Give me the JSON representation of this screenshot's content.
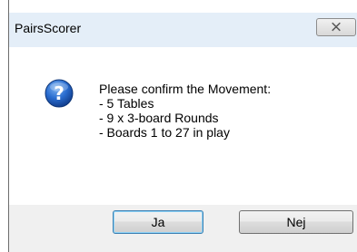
{
  "window": {
    "title": "PairsScorer",
    "close_icon": "close-icon"
  },
  "dialog": {
    "icon": "question-icon",
    "message_lines": [
      "Please confirm the Movement:",
      "- 5 Tables",
      "- 9 x 3-board Rounds",
      "- Boards 1 to 27 in play"
    ]
  },
  "buttons": {
    "yes_label": "Ja",
    "no_label": "Nej"
  },
  "colors": {
    "titlebar": "#e4eef8",
    "footer": "#f0f0f0",
    "icon_blue": "#1f5fc2"
  }
}
